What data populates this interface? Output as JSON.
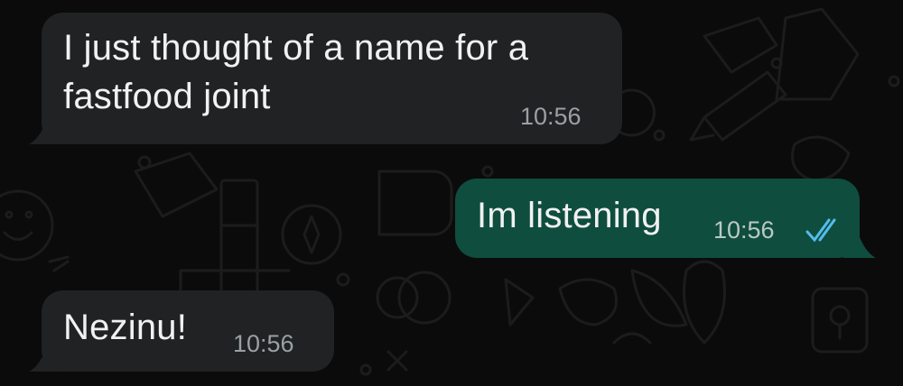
{
  "chat": {
    "messages": [
      {
        "direction": "incoming",
        "text": "I just thought of a name for a fastfood joint",
        "line1": "I just thought of a name for a",
        "line2": "fastfood joint",
        "time": "10:56"
      },
      {
        "direction": "outgoing",
        "text": "Im listening",
        "time": "10:56",
        "status_icon": "double-check-read-icon",
        "status_color": "#53bdeb"
      },
      {
        "direction": "incoming",
        "text": "Nezinu!",
        "time": "10:56"
      }
    ]
  },
  "colors": {
    "background": "#0b0b0b",
    "incoming_bubble": "#202223",
    "outgoing_bubble": "#0f4d3f",
    "read_ticks": "#53bdeb"
  }
}
